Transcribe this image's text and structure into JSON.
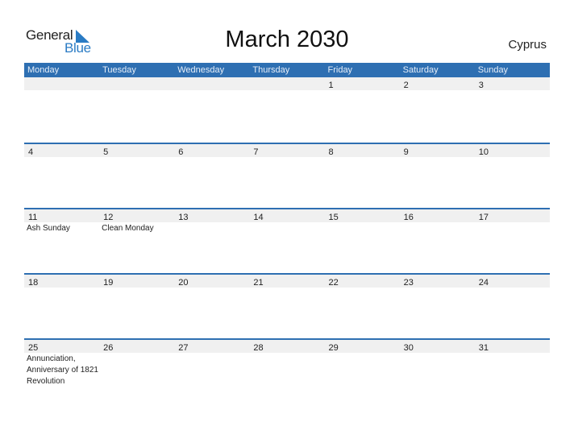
{
  "logo": {
    "general": "General",
    "blue": "Blue",
    "brand_color": "#2a7bc4"
  },
  "title": "March 2030",
  "country": "Cyprus",
  "colors": {
    "header_bg": "#2e6fb2",
    "date_strip_bg": "#f0f0f0"
  },
  "weekdays": [
    "Monday",
    "Tuesday",
    "Wednesday",
    "Thursday",
    "Friday",
    "Saturday",
    "Sunday"
  ],
  "weeks": [
    {
      "days": [
        {
          "num": "",
          "event": ""
        },
        {
          "num": "",
          "event": ""
        },
        {
          "num": "",
          "event": ""
        },
        {
          "num": "",
          "event": ""
        },
        {
          "num": "1",
          "event": ""
        },
        {
          "num": "2",
          "event": ""
        },
        {
          "num": "3",
          "event": ""
        }
      ]
    },
    {
      "days": [
        {
          "num": "4",
          "event": ""
        },
        {
          "num": "5",
          "event": ""
        },
        {
          "num": "6",
          "event": ""
        },
        {
          "num": "7",
          "event": ""
        },
        {
          "num": "8",
          "event": ""
        },
        {
          "num": "9",
          "event": ""
        },
        {
          "num": "10",
          "event": ""
        }
      ]
    },
    {
      "days": [
        {
          "num": "11",
          "event": "Ash Sunday"
        },
        {
          "num": "12",
          "event": "Clean Monday"
        },
        {
          "num": "13",
          "event": ""
        },
        {
          "num": "14",
          "event": ""
        },
        {
          "num": "15",
          "event": ""
        },
        {
          "num": "16",
          "event": ""
        },
        {
          "num": "17",
          "event": ""
        }
      ]
    },
    {
      "days": [
        {
          "num": "18",
          "event": ""
        },
        {
          "num": "19",
          "event": ""
        },
        {
          "num": "20",
          "event": ""
        },
        {
          "num": "21",
          "event": ""
        },
        {
          "num": "22",
          "event": ""
        },
        {
          "num": "23",
          "event": ""
        },
        {
          "num": "24",
          "event": ""
        }
      ]
    },
    {
      "days": [
        {
          "num": "25",
          "event": "Annunciation, Anniversary of 1821 Revolution"
        },
        {
          "num": "26",
          "event": ""
        },
        {
          "num": "27",
          "event": ""
        },
        {
          "num": "28",
          "event": ""
        },
        {
          "num": "29",
          "event": ""
        },
        {
          "num": "30",
          "event": ""
        },
        {
          "num": "31",
          "event": ""
        }
      ]
    }
  ]
}
